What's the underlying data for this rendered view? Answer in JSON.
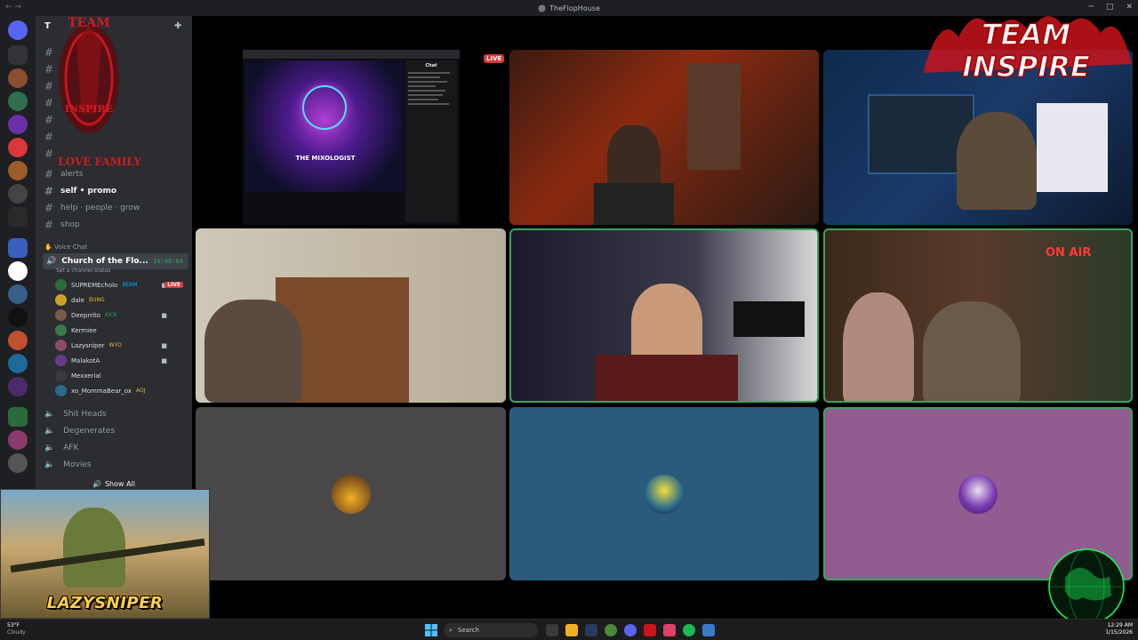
{
  "window": {
    "title": "TheFlopHouse",
    "min_glyph": "─",
    "max_glyph": "□",
    "close_glyph": "✕",
    "nav_back": "←",
    "nav_forward": "→"
  },
  "server": {
    "name": "T"
  },
  "channels": [
    {
      "name": "alerts"
    },
    {
      "name": "self • promo"
    },
    {
      "name": "help · people · grow"
    },
    {
      "name": "shop"
    }
  ],
  "voice_category": "Voice Chat",
  "active_voice": {
    "name": "Church of the Flo...",
    "timer": "10:48:04",
    "status": "Set a channel status"
  },
  "voice_users": [
    {
      "name": "SUPREMEcholo",
      "badge": "BEAM",
      "live": "LIVE"
    },
    {
      "name": "dale",
      "badge": "BUNG"
    },
    {
      "name": "Deeprrito",
      "badge": "KICK"
    },
    {
      "name": "Kermiee"
    },
    {
      "name": "Lazysniper",
      "badge": "WYO"
    },
    {
      "name": "MalakotA"
    },
    {
      "name": "Mexxerial"
    },
    {
      "name": "xo_MommaBear_ox",
      "badge": "AOJ"
    }
  ],
  "voice_channels": [
    {
      "name": "Shit Heads"
    },
    {
      "name": "Degenerates"
    },
    {
      "name": "AFK"
    },
    {
      "name": "Movies"
    }
  ],
  "show_all": "Show All",
  "stream_tile": {
    "live_badge": "LIVE",
    "chat_header": "Chat",
    "overlay_title": "THE MIXOLOGIST"
  },
  "overlays": {
    "team_logo_top": "TEAM",
    "team_logo_bottom": "INSPIRE",
    "left_logo_top": "TEAM",
    "left_logo_mid": "INSPIRE",
    "left_logo_bottom": "LOVE FAMILY",
    "sniper_label": "LAZYSNIPER",
    "on_air": "ON AIR"
  },
  "taskbar": {
    "temp": "53°F",
    "condition": "Cloudy",
    "search": "Search",
    "time": "12:29 AM",
    "date": "1/15/2026"
  },
  "colors": {
    "tile_grey": "#4a4749",
    "tile_blue": "#2c5a7d",
    "tile_purple": "#915c90",
    "speaking_green": "#3ba55c"
  }
}
